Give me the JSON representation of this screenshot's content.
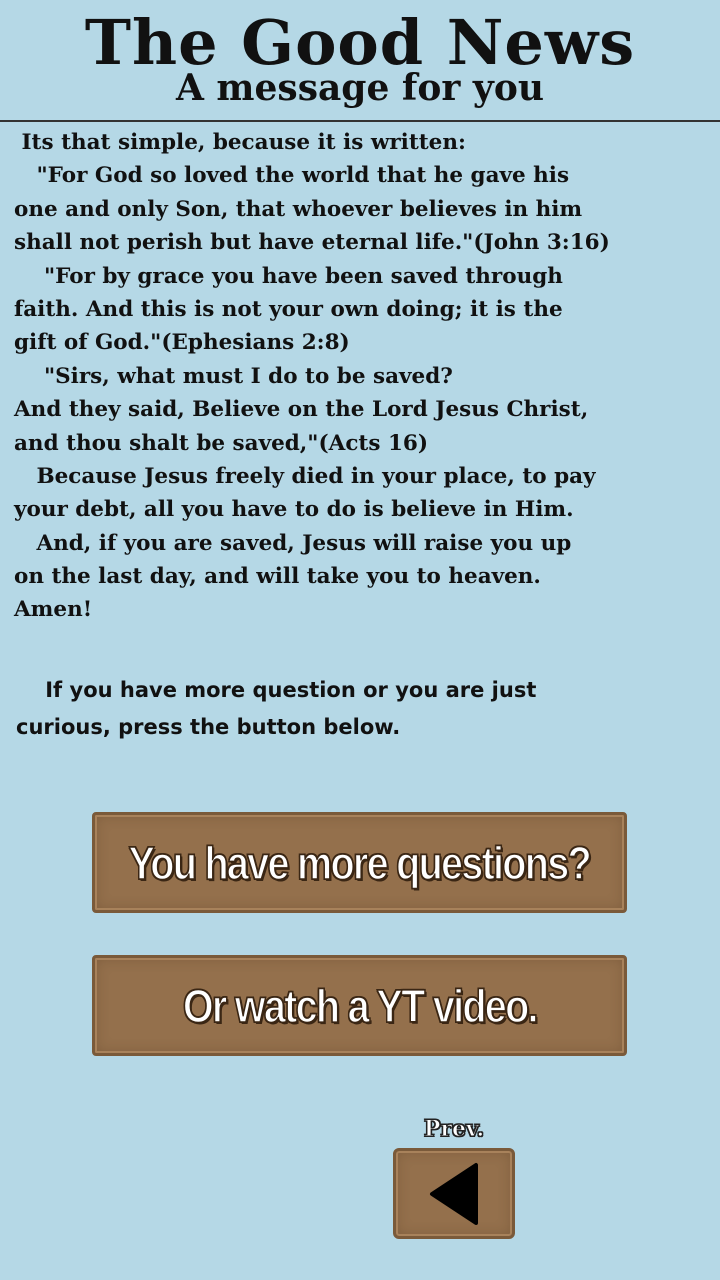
{
  "header": {
    "title": "The Good News",
    "subtitle": "A message for you"
  },
  "body": {
    "lines": [
      " Its that simple, because it is written:",
      "   \"For God so loved the world that he gave his",
      "one and only Son, that whoever believes in him",
      "shall not perish but have eternal life.\"(John 3:16)",
      "    \"For by grace you have been saved through",
      "faith. And this is not your own doing; it is the",
      "gift of God.\"(Ephesians 2:8)",
      "    \"Sirs, what must I do to be saved?",
      "And they said, Believe on the Lord Jesus Christ,",
      "and thou shalt be saved,\"(Acts 16)",
      "   Because Jesus freely died in your place, to pay",
      "your debt, all you have to do is believe in Him.",
      "   And, if you are saved, Jesus will raise you up",
      "on the last day, and will take you to heaven.",
      "Amen!"
    ]
  },
  "invite": {
    "line1": "    If you have more question or you are just",
    "line2": "curious, press the button below."
  },
  "buttons": {
    "questions_label": "You have more questions?",
    "video_label": "Or watch a YT video.",
    "prev_label": "Prev."
  },
  "icons": {
    "prev": "triangle-left-icon"
  },
  "colors": {
    "background": "#b5d8e6",
    "button_wood": "#94704c",
    "text": "#111111"
  }
}
